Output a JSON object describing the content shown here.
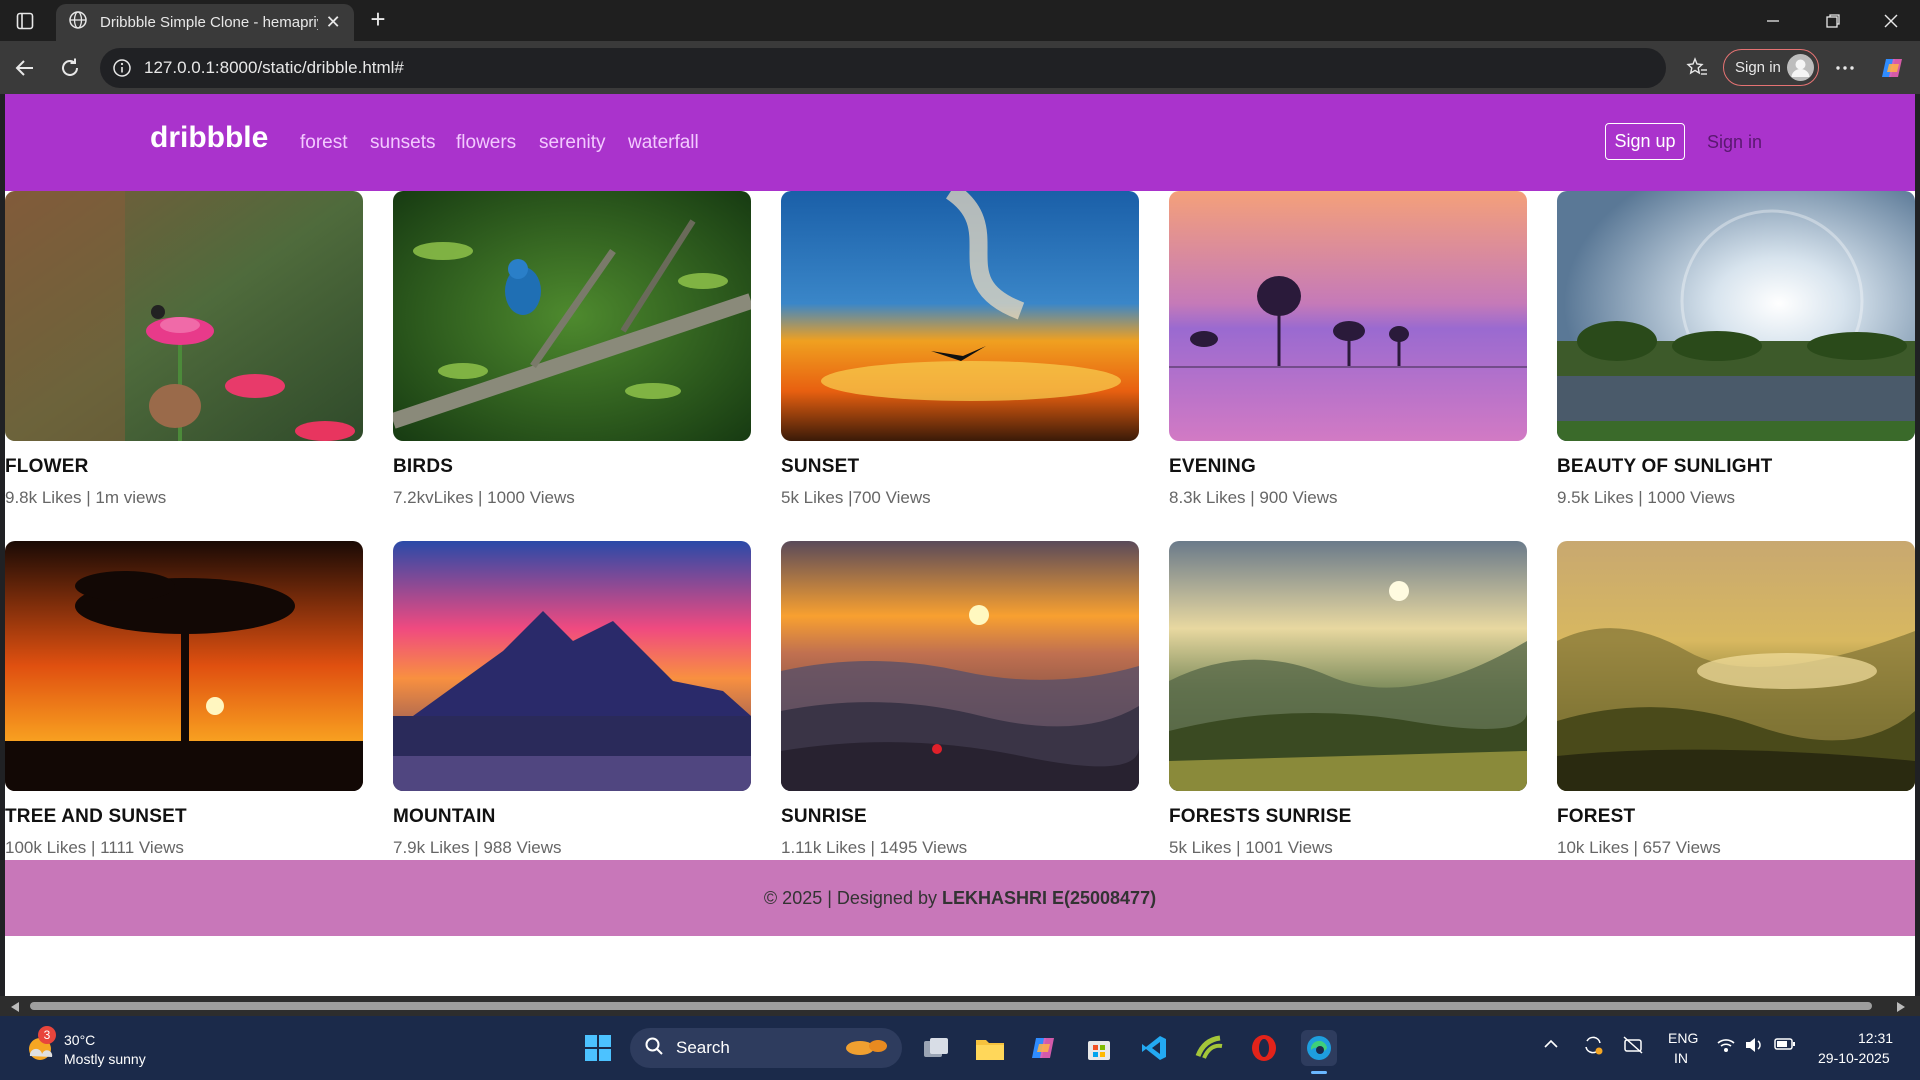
{
  "browser": {
    "tab_title": "Dribbble Simple Clone - hemapriy",
    "url": "127.0.0.1:8000/static/dribble.html#",
    "signin_label": "Sign in"
  },
  "site": {
    "brand": "dribbble",
    "nav": [
      "forest",
      "sunsets",
      "flowers",
      "serenity",
      "waterfall"
    ],
    "signup_label": "Sign up",
    "signin_label": "Sign in"
  },
  "cards": [
    {
      "title": "FLOWER",
      "meta": "9.8k Likes | 1m views"
    },
    {
      "title": "BIRDS",
      "meta": "7.2kvLikes | 1000 Views"
    },
    {
      "title": "SUNSET",
      "meta": "5k Likes |700 Views"
    },
    {
      "title": "EVENING",
      "meta": "8.3k Likes | 900 Views"
    },
    {
      "title": "BEAUTY OF SUNLIGHT",
      "meta": "9.5k Likes | 1000 Views"
    },
    {
      "title": "TREE AND SUNSET",
      "meta": "100k Likes | 1111 Views"
    },
    {
      "title": "MOUNTAIN",
      "meta": "7.9k Likes | 988 Views"
    },
    {
      "title": "SUNRISE",
      "meta": "1.11k Likes | 1495 Views"
    },
    {
      "title": "FORESTS SUNRISE",
      "meta": "5k Likes | 1001 Views"
    },
    {
      "title": "FOREST",
      "meta": "10k Likes | 657 Views"
    }
  ],
  "footer": {
    "text": "© 2025 | Designed by",
    "author": "LEKHASHRI E(25008477)"
  },
  "taskbar": {
    "weather_temp": "30°C",
    "weather_desc": "Mostly sunny",
    "weather_badge": "3",
    "search_label": "Search",
    "lang_top": "ENG",
    "lang_bottom": "IN",
    "time": "12:31",
    "date": "29-10-2025"
  }
}
